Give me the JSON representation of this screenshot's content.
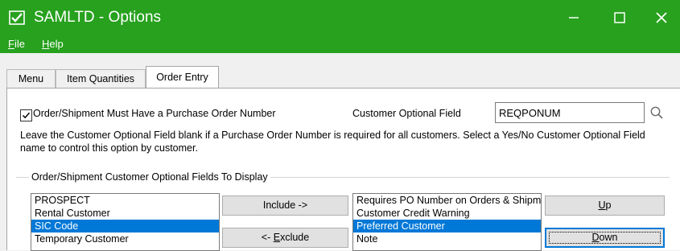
{
  "window": {
    "title": "SAMLTD - Options",
    "accent_color": "#27a11e",
    "icons": [
      "app-check-icon",
      "minimize-icon",
      "maximize-icon",
      "close-icon"
    ]
  },
  "menu": {
    "file_mnemonic": "F",
    "file_rest": "ile",
    "help_mnemonic": "H",
    "help_rest": "elp"
  },
  "tabs": [
    {
      "label": "Menu"
    },
    {
      "label": "Item Quantities"
    },
    {
      "label": "Order Entry",
      "selected": true
    }
  ],
  "order_entry": {
    "must_have_po": {
      "label": "Order/Shipment Must Have a Purchase Order Number",
      "checked": true
    },
    "customer_optional_field": {
      "label": "Customer Optional Field",
      "value": "REQPONUM"
    },
    "note": "Leave the Customer Optional Field blank if a Purchase Order Number is required for all customers. Select a Yes/No Customer Optional Field name to control this option by customer.",
    "group_title": "Order/Shipment Customer Optional Fields To Display",
    "available_fields": [
      {
        "label": "PROSPECT",
        "selected": false
      },
      {
        "label": "Rental Customer",
        "selected": false
      },
      {
        "label": "SIC Code",
        "selected": true
      },
      {
        "label": "Temporary Customer",
        "selected": false
      }
    ],
    "displayed_fields": [
      {
        "label": "Requires PO Number on Orders & Shipments",
        "selected": false
      },
      {
        "label": "Customer Credit Warning",
        "selected": false
      },
      {
        "label": "Preferred Customer",
        "selected": true
      },
      {
        "label": "Note",
        "selected": false
      }
    ],
    "buttons": {
      "include": "Include ->",
      "exclude_pre": "<- ",
      "exclude_mnemonic": "E",
      "exclude_rest": "xclude",
      "up_mnemonic": "U",
      "up_rest": "p",
      "down_mnemonic": "D",
      "down_rest": "own"
    },
    "selection_color": "#0078d7"
  }
}
